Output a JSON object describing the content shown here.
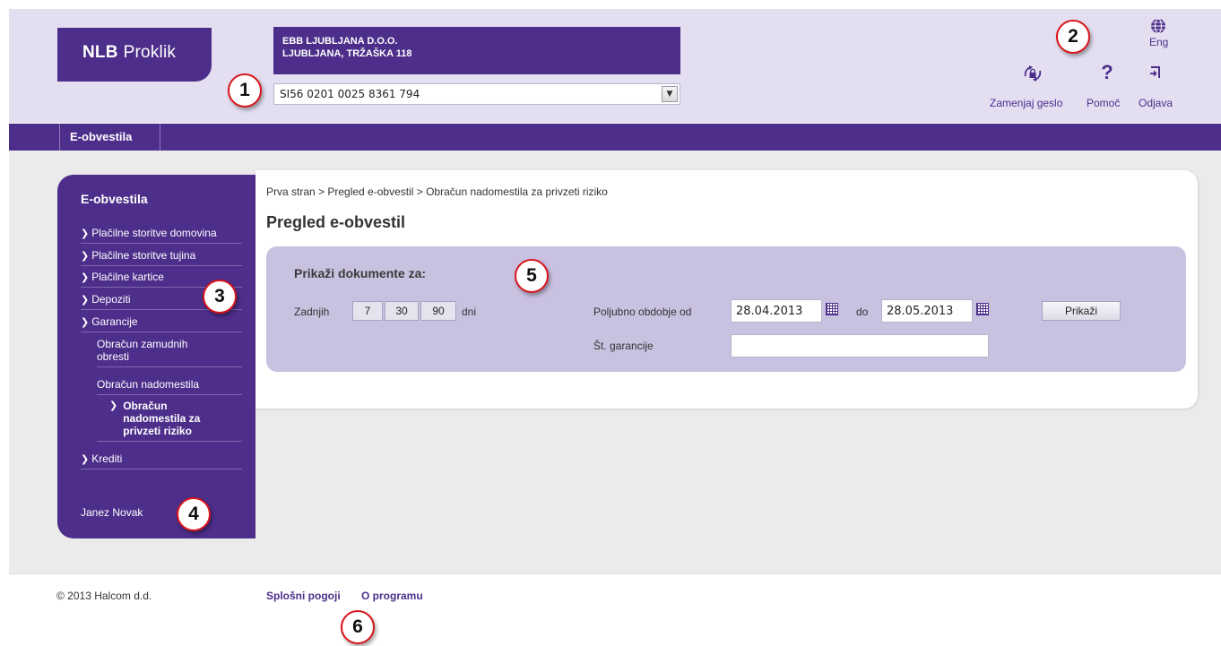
{
  "header": {
    "logo": {
      "bold": "NLB",
      "rest": "Proklik"
    },
    "company": {
      "name": "EBB LJUBLJANA D.O.O.",
      "address": "LJUBLJANA, TRŽAŠKA 118"
    },
    "account": {
      "value": "SI56 0201 0025 8361 794"
    },
    "language": {
      "label": "Eng",
      "icon": "globe-icon"
    },
    "actions": [
      {
        "label": "Zamenjaj geslo",
        "icon": "lock-refresh-icon"
      },
      {
        "label": "Pomoč",
        "icon": "question-icon"
      },
      {
        "label": "Odjava",
        "icon": "logout-icon"
      }
    ]
  },
  "nav": {
    "tab": "E-obvestila"
  },
  "sidebar": {
    "title": "E-obvestila",
    "items": [
      {
        "label": "Plačilne storitve domovina"
      },
      {
        "label": "Plačilne storitve tujina"
      },
      {
        "label": "Plačilne kartice"
      },
      {
        "label": "Depoziti"
      },
      {
        "label": "Garancije"
      },
      {
        "label": "Obračun zamudnih obresti"
      },
      {
        "label": "Obračun nadomestila"
      },
      {
        "label": "Obračun nadomestila za privzeti riziko"
      },
      {
        "label": "Krediti"
      }
    ],
    "user": "Janez Novak"
  },
  "main": {
    "breadcrumb": "Prva stran > Pregled e-obvestil > Obračun nadomestila za privzeti riziko",
    "title": "Pregled e-obvestil",
    "filter": {
      "title": "Prikaži dokumente za:",
      "last_label": "Zadnjih",
      "day_buttons": [
        "7",
        "30",
        "90"
      ],
      "days_label": "dni",
      "range_label": "Poljubno obdobje od",
      "date_from": "28.04.2013",
      "to_label": "do",
      "date_to": "28.05.2013",
      "guarantee_label": "Št. garancije",
      "guarantee_value": "",
      "show_button": "Prikaži"
    }
  },
  "footer": {
    "copyright": "© 2013 Halcom d.d.",
    "links": [
      "Splošni pogoji",
      "O programu"
    ]
  },
  "callouts": [
    "1",
    "2",
    "3",
    "4",
    "5",
    "6"
  ],
  "colors": {
    "brand": "#4d2e8b",
    "header_bg": "#e3dff1",
    "filter_bg": "#c9c1e0",
    "callout_border": "#d9141b"
  }
}
